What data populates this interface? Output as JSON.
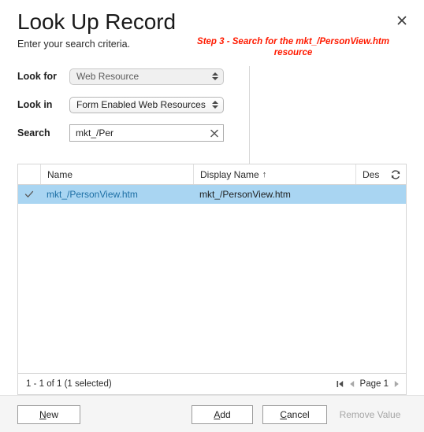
{
  "dialog": {
    "title": "Look Up Record",
    "subtitle": "Enter your search criteria.",
    "close_icon": "close-icon",
    "annotation": "Step 3 - Search for the mkt_/PersonView.htm resource",
    "annotation_color": "#ff1a00"
  },
  "criteria": {
    "look_for": {
      "label": "Look for",
      "value": "Web Resource",
      "stepper_icon": "updown-stepper-icon"
    },
    "look_in": {
      "label": "Look in",
      "value": "Form Enabled Web Resources",
      "stepper_icon": "updown-stepper-icon"
    },
    "search": {
      "label": "Search",
      "value": "mkt_/Per",
      "placeholder": "",
      "clear_icon": "clear-x-icon"
    }
  },
  "grid": {
    "columns": [
      {
        "key": "check",
        "label": ""
      },
      {
        "key": "name",
        "label": "Name"
      },
      {
        "key": "display_name",
        "label": "Display Name",
        "sort": "↑"
      },
      {
        "key": "description",
        "label": "Des"
      }
    ],
    "refresh_icon": "refresh-icon",
    "rows": [
      {
        "selected": true,
        "check_icon": "checkmark-icon",
        "name": "mkt_/PersonView.htm",
        "display_name": "mkt_/PersonView.htm",
        "description": ""
      }
    ],
    "footer": {
      "record_count": "1 - 1 of 1 (1 selected)",
      "first_page_icon": "first-page-icon",
      "prev_page_icon": "prev-page-icon",
      "page_label": "Page 1",
      "next_page_icon": "next-page-icon"
    },
    "selected_row_color": "#a9d5f2",
    "link_color": "#1d6fa5"
  },
  "footer_buttons": {
    "new": {
      "label": "New",
      "accelerator": "N",
      "disabled": false
    },
    "add": {
      "label": "Add",
      "accelerator": "A",
      "disabled": false
    },
    "cancel": {
      "label": "Cancel",
      "accelerator": "C",
      "disabled": false
    },
    "remove_value": {
      "label": "Remove Value",
      "accelerator": "",
      "disabled": true
    }
  }
}
